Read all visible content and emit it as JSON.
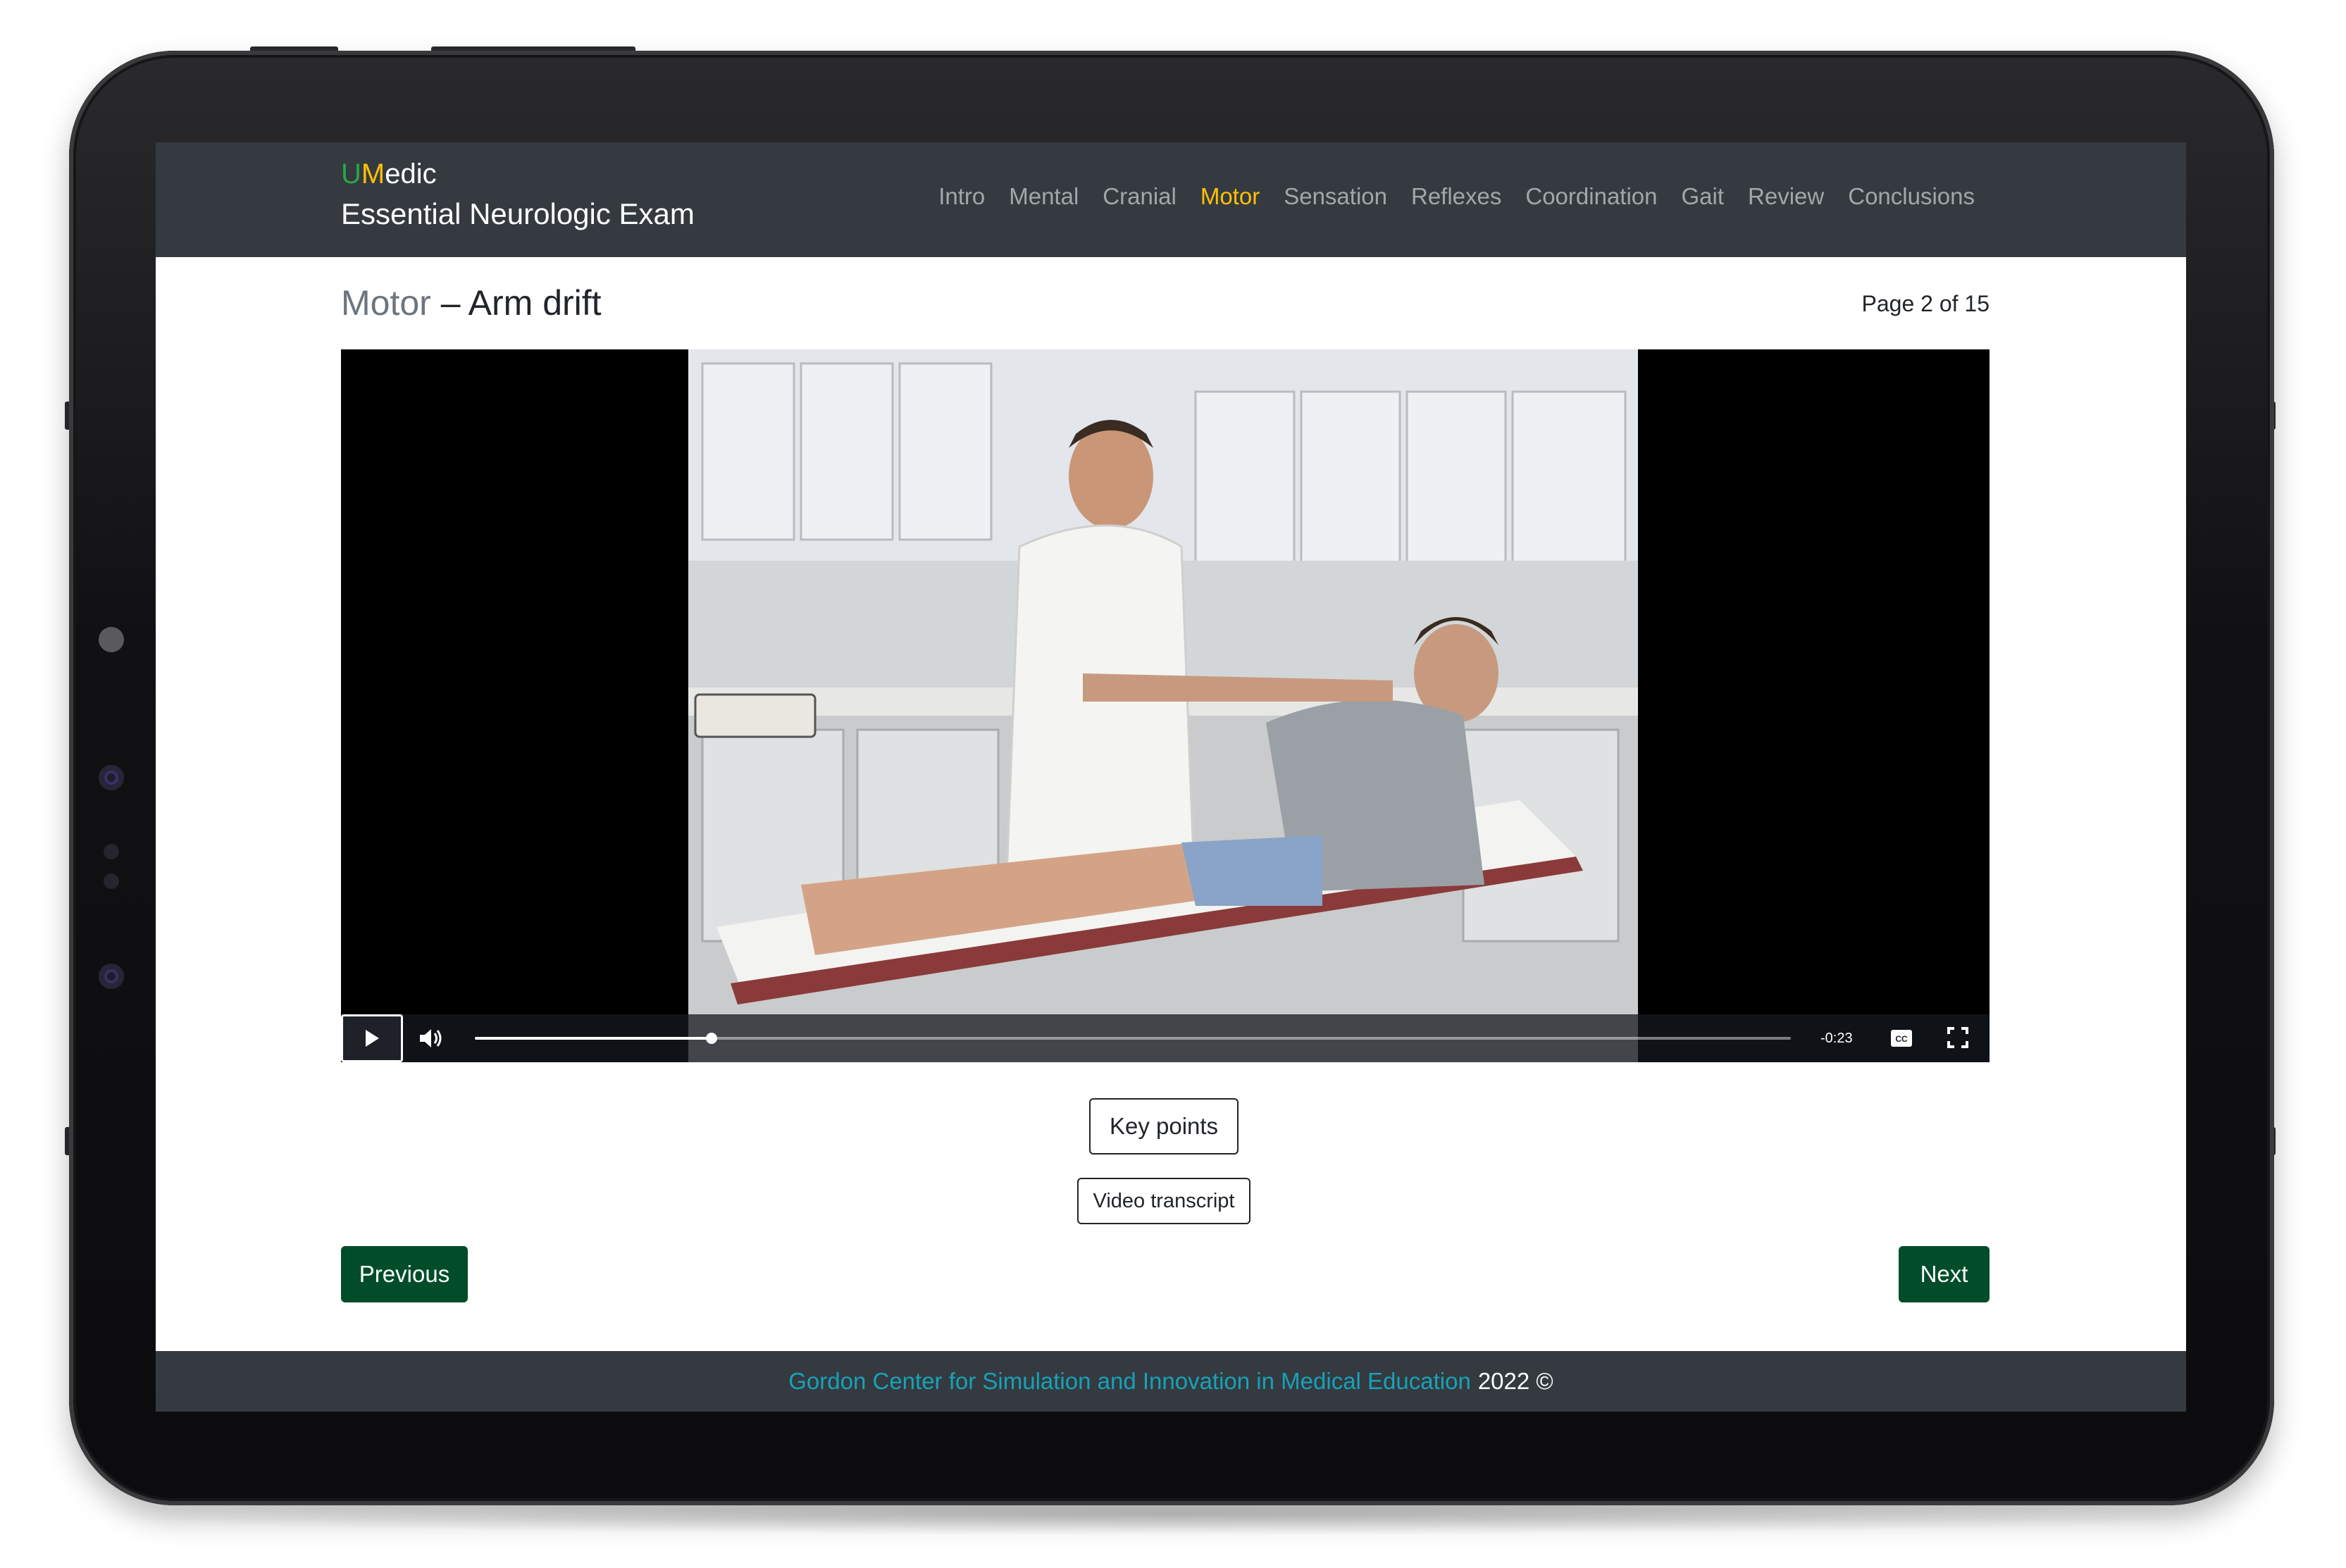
{
  "brand": {
    "logo_u": "U",
    "logo_m": "M",
    "logo_rest": "edic",
    "subtitle": "Essential Neurologic Exam"
  },
  "nav": {
    "items": [
      {
        "label": "Intro",
        "active": false
      },
      {
        "label": "Mental",
        "active": false
      },
      {
        "label": "Cranial",
        "active": false
      },
      {
        "label": "Motor",
        "active": true
      },
      {
        "label": "Sensation",
        "active": false
      },
      {
        "label": "Reflexes",
        "active": false
      },
      {
        "label": "Coordination",
        "active": false
      },
      {
        "label": "Gait",
        "active": false
      },
      {
        "label": "Review",
        "active": false
      },
      {
        "label": "Conclusions",
        "active": false
      }
    ]
  },
  "page": {
    "section": "Motor",
    "separator": " – ",
    "topic": "Arm drift",
    "count": "Page 2 of 15"
  },
  "video": {
    "time_remaining": "-0:23",
    "progress": 0.18,
    "play_icon": "play-icon",
    "volume_icon": "volume-icon",
    "cc_icon": "closed-captions-icon",
    "fullscreen_icon": "fullscreen-icon"
  },
  "buttons": {
    "key_points": "Key points",
    "video_transcript": "Video transcript",
    "previous": "Previous",
    "next": "Next"
  },
  "footer": {
    "link": "Gordon Center for Simulation and Innovation in Medical Education",
    "text": "2022 ©"
  },
  "colors": {
    "navbar": "#343a40",
    "active_nav": "#ffc107",
    "brand_u": "#28a745",
    "button_green": "#014d2a",
    "footer_link": "#17a2b8"
  }
}
